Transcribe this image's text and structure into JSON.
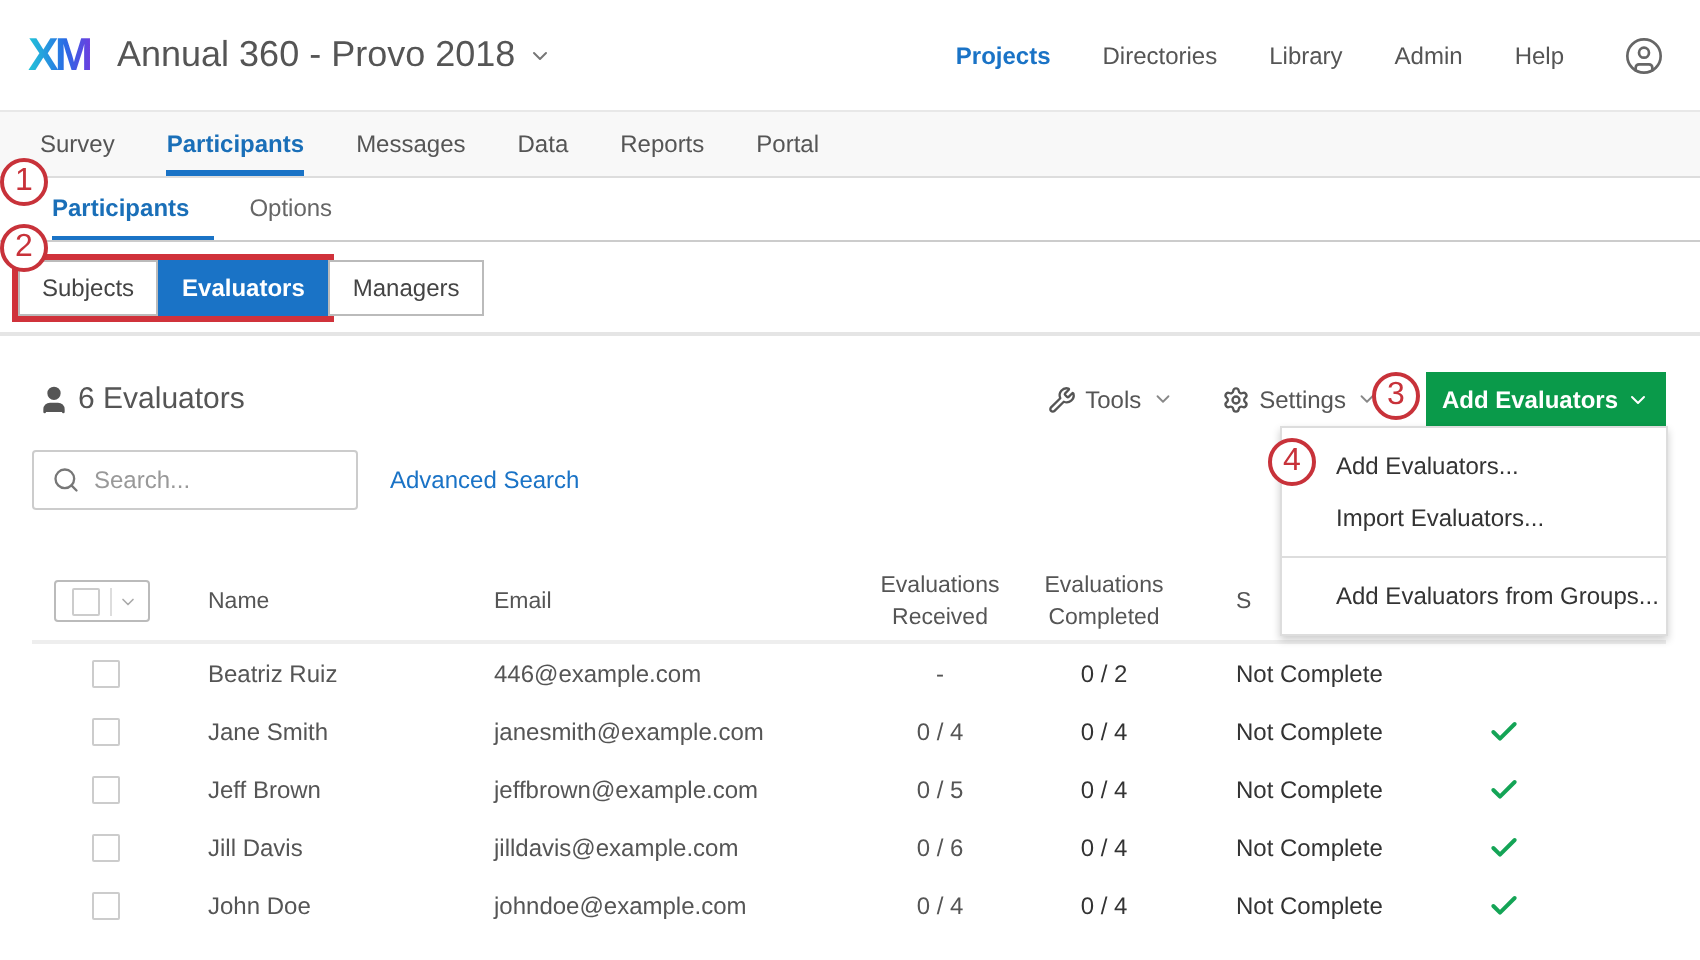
{
  "header": {
    "logo": "XM",
    "title": "Annual 360 - Provo 2018",
    "nav": [
      {
        "label": "Projects",
        "selected": true
      },
      {
        "label": "Directories",
        "selected": false
      },
      {
        "label": "Library",
        "selected": false
      },
      {
        "label": "Admin",
        "selected": false
      },
      {
        "label": "Help",
        "selected": false
      }
    ]
  },
  "tabs": [
    {
      "label": "Survey",
      "selected": false
    },
    {
      "label": "Participants",
      "selected": true
    },
    {
      "label": "Messages",
      "selected": false
    },
    {
      "label": "Data",
      "selected": false
    },
    {
      "label": "Reports",
      "selected": false
    },
    {
      "label": "Portal",
      "selected": false
    }
  ],
  "subtabs": [
    {
      "label": "Participants",
      "selected": true
    },
    {
      "label": "Options",
      "selected": false
    }
  ],
  "segments": [
    {
      "label": "Subjects",
      "selected": false,
      "highlighted": true
    },
    {
      "label": "Evaluators",
      "selected": true,
      "highlighted": true
    },
    {
      "label": "Managers",
      "selected": false,
      "highlighted": false
    }
  ],
  "callouts": [
    "1",
    "2",
    "3",
    "4"
  ],
  "summary": {
    "count_label": "6 Evaluators"
  },
  "toolbar": {
    "tools": "Tools",
    "settings": "Settings",
    "add": "Add Evaluators"
  },
  "menu": {
    "expanded": true,
    "groups": [
      [
        "Add Evaluators...",
        "Import Evaluators..."
      ],
      [
        "Add Evaluators from Groups..."
      ]
    ]
  },
  "search": {
    "placeholder": "Search..."
  },
  "advanced_search": "Advanced Search",
  "table": {
    "select_all_checked": false,
    "columns": [
      "Name",
      "Email",
      "Evaluations Received",
      "Evaluations Completed",
      "S"
    ],
    "rows": [
      {
        "name": "Beatriz Ruiz",
        "email": "446@example.com",
        "received": "-",
        "completed": "0 / 2",
        "status": "Not Complete",
        "checked": false,
        "done": false
      },
      {
        "name": "Jane Smith",
        "email": "janesmith@example.com",
        "received": "0 / 4",
        "completed": "0 / 4",
        "status": "Not Complete",
        "checked": false,
        "done": true
      },
      {
        "name": "Jeff Brown",
        "email": "jeffbrown@example.com",
        "received": "0 / 5",
        "completed": "0 / 4",
        "status": "Not Complete",
        "checked": false,
        "done": true
      },
      {
        "name": "Jill Davis",
        "email": "jilldavis@example.com",
        "received": "0 / 6",
        "completed": "0 / 4",
        "status": "Not Complete",
        "checked": false,
        "done": true
      },
      {
        "name": "John Doe",
        "email": "johndoe@example.com",
        "received": "0 / 4",
        "completed": "0 / 4",
        "status": "Not Complete",
        "checked": false,
        "done": true
      }
    ]
  }
}
